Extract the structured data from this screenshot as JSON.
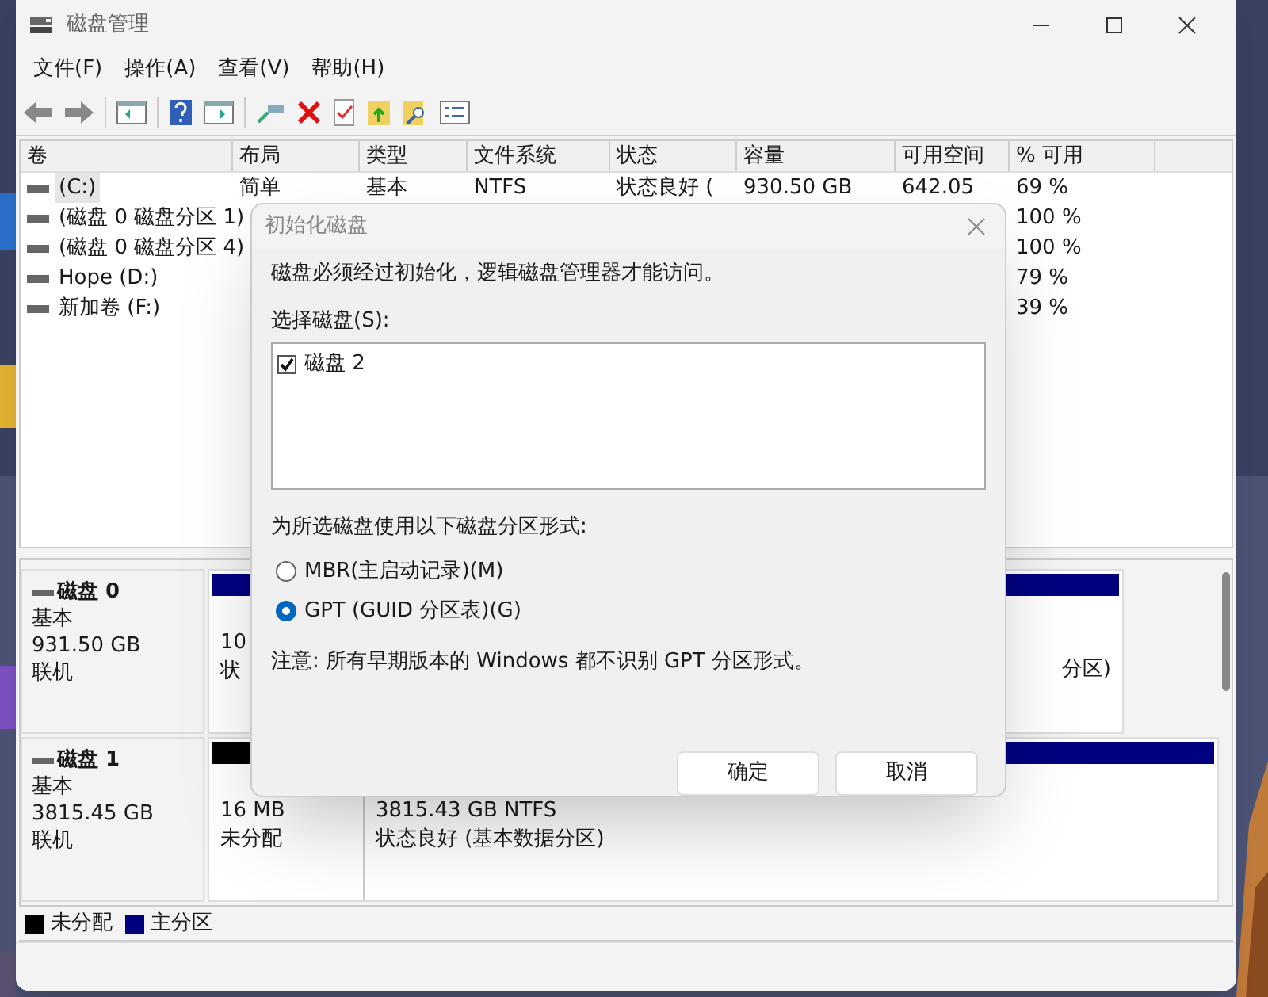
{
  "window": {
    "title": "磁盘管理"
  },
  "menu": [
    "文件(F)",
    "操作(A)",
    "查看(V)",
    "帮助(H)"
  ],
  "volume_table": {
    "columns": [
      "卷",
      "布局",
      "类型",
      "文件系统",
      "状态",
      "容量",
      "可用空间",
      "% 可用"
    ],
    "rows": [
      {
        "volume": "(C:)",
        "layout": "简单",
        "type": "基本",
        "file_system": "NTFS",
        "status": "状态良好 (",
        "capacity": "930.50 GB",
        "free_space": "642.05",
        "percent_free": "69 %",
        "selected": true
      },
      {
        "volume": "(磁盘 0 磁盘分区 1)",
        "percent_free": "100 %",
        "selected": false
      },
      {
        "volume": "(磁盘 0 磁盘分区 4)",
        "percent_free": "100 %",
        "selected": false
      },
      {
        "volume": "Hope (D:)",
        "percent_free": "79 %",
        "selected": false
      },
      {
        "volume": "新加卷 (F:)",
        "percent_free": "39 %",
        "selected": false
      }
    ]
  },
  "disks": [
    {
      "name": "磁盘 0",
      "type": "基本",
      "size": "931.50 GB",
      "state": "联机",
      "partitions": [
        {
          "kind": "primary",
          "lines": [
            "10",
            "状"
          ]
        },
        {
          "kind": "primary",
          "lines": [
            "分区)"
          ]
        }
      ]
    },
    {
      "name": "磁盘 1",
      "type": "基本",
      "size": "3815.45 GB",
      "state": "联机",
      "partitions": [
        {
          "kind": "unallocated",
          "lines": [
            "16 MB",
            "未分配"
          ]
        },
        {
          "kind": "primary",
          "lines": [
            "3815.43 GB NTFS",
            "状态良好 (基本数据分区)"
          ]
        }
      ]
    }
  ],
  "legend": [
    {
      "kind": "unallocated",
      "label": "未分配"
    },
    {
      "kind": "primary",
      "label": "主分区"
    }
  ],
  "dialog": {
    "title": "初始化磁盘",
    "message": "磁盘必须经过初始化，逻辑磁盘管理器才能访问。",
    "disk_list_label": "选择磁盘(S):",
    "disk_items": [
      {
        "label": "磁盘 2",
        "checked": true
      }
    ],
    "style_label": "为所选磁盘使用以下磁盘分区形式:",
    "styles": [
      {
        "label": "MBR(主启动记录)(M)",
        "selected": false
      },
      {
        "label": "GPT (GUID 分区表)(G)",
        "selected": true
      }
    ],
    "note": "注意: 所有早期版本的 Windows 都不识别 GPT 分区形式。",
    "buttons": [
      "确定",
      "取消"
    ]
  }
}
